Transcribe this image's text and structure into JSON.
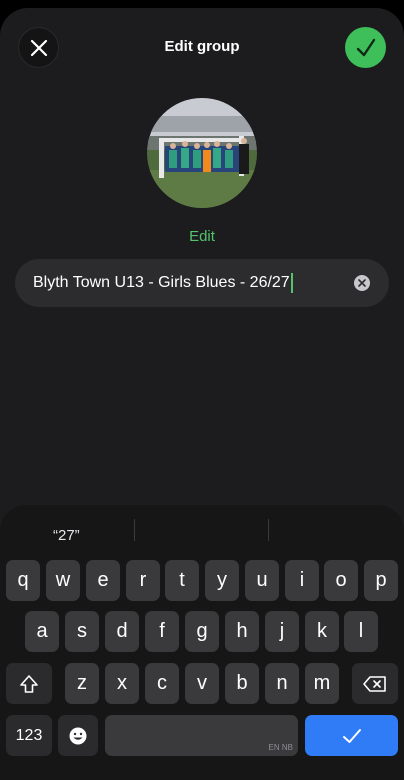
{
  "header": {
    "title": "Edit group",
    "close_icon": "close-icon",
    "confirm_icon": "check-icon"
  },
  "avatar": {
    "edit_label": "Edit"
  },
  "name_field": {
    "value": "Blyth Town U13 - Girls Blues - 26/27",
    "clear_icon": "clear-icon"
  },
  "keyboard": {
    "suggestions": [
      "“27”",
      "",
      ""
    ],
    "row1": [
      "q",
      "w",
      "e",
      "r",
      "t",
      "y",
      "u",
      "i",
      "o",
      "p"
    ],
    "row2": [
      "a",
      "s",
      "d",
      "f",
      "g",
      "h",
      "j",
      "k",
      "l"
    ],
    "row3": [
      "z",
      "x",
      "c",
      "v",
      "b",
      "n",
      "m"
    ],
    "numbers_key": "123",
    "space_hint": "EN NB",
    "shift_icon": "shift-icon",
    "backspace_icon": "backspace-icon",
    "emoji_icon": "emoji-icon",
    "enter_icon": "check-icon"
  },
  "colors": {
    "accent_green": "#52c46c",
    "confirm_green": "#3fbf5a",
    "enter_blue": "#2f7cf6",
    "background": "#1c1c1e"
  }
}
